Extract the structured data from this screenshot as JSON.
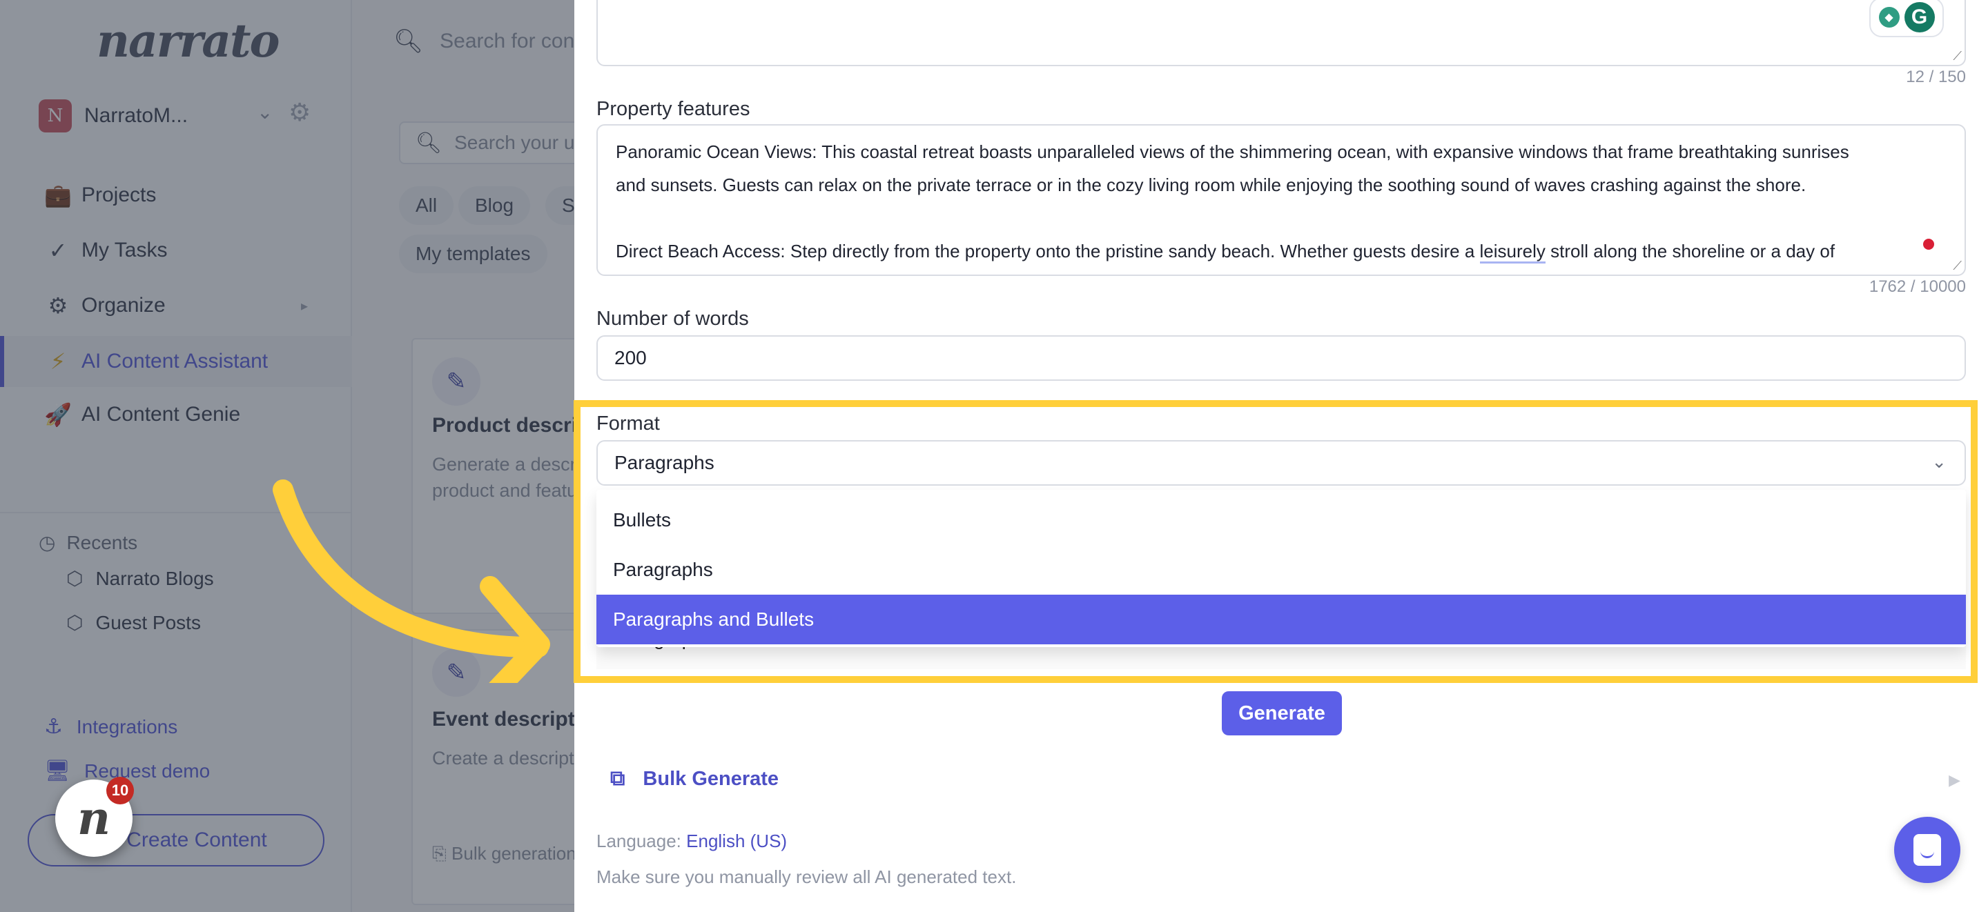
{
  "sidebar": {
    "logo": "narrato",
    "workspace": {
      "initial": "N",
      "name": "NarratoM...",
      "avatar_color": "#c95b66"
    },
    "nav": [
      {
        "label": "Projects",
        "icon": "briefcase-icon"
      },
      {
        "label": "My Tasks",
        "icon": "checkmarks-icon"
      },
      {
        "label": "Organize",
        "icon": "gears-icon"
      },
      {
        "label": "AI Content Assistant",
        "icon": "lightning-icon",
        "active": true
      },
      {
        "label": "AI Content Genie",
        "icon": "rocket-icon"
      }
    ],
    "recents": {
      "heading": "Recents",
      "items": [
        {
          "label": "Narrato Blogs",
          "icon": "cube-icon"
        },
        {
          "label": "Guest Posts",
          "icon": "cube-icon"
        }
      ]
    },
    "links": [
      {
        "label": "Integrations",
        "icon": "anchor-icon"
      },
      {
        "label": "Request demo",
        "icon": "monitor-icon"
      }
    ],
    "create_button": "Create Content",
    "widget": {
      "letter": "n",
      "badge": "10"
    }
  },
  "background": {
    "top_search_placeholder": "Search for content",
    "template_search_placeholder": "Search your use case",
    "filters": [
      "All",
      "Blog",
      "S",
      "My templates"
    ],
    "cards": [
      {
        "title": "Product description",
        "desc_lines": [
          "Generate a description for a",
          "product and features"
        ]
      },
      {
        "title": "Event description",
        "desc_lines": [
          "Create a description"
        ],
        "bulk": "Bulk generation"
      }
    ]
  },
  "form": {
    "first_counter": "12 / 150",
    "property_features": {
      "label": "Property features",
      "lines": [
        "Panoramic Ocean Views: This coastal retreat boasts unparalleled views of the shimmering ocean, with expansive windows that frame breathtaking sunrises",
        "and sunsets. Guests can relax on the private terrace or in the cozy living room while enjoying the soothing sound of waves crashing against the shore.",
        "",
        "Direct Beach Access: Step directly from the property onto the pristine sandy beach. Whether guests desire a ",
        "leisurely",
        " stroll along the shoreline or a day of"
      ],
      "counter": "1762 / 10000"
    },
    "number_of_words": {
      "label": "Number of words",
      "value": "200"
    },
    "format": {
      "label": "Format",
      "selected": "Paragraphs",
      "options": [
        "Bullets",
        "Paragraphs",
        "Paragraphs and Bullets"
      ],
      "highlighted_option": "Paragraphs and Bullets"
    },
    "hidden_field_peek": "Paragraphs and Bullets",
    "generate_button": "Generate",
    "bulk_generate": "Bulk Generate",
    "language_label": "Language: ",
    "language_value": "English (US)",
    "disclaimer": "Make sure you manually review all AI generated text."
  },
  "colors": {
    "accent": "#5c5fe8",
    "highlight_annotation": "#ffcf3a",
    "badge": "#c42a24",
    "grammarly": "#157a63"
  }
}
